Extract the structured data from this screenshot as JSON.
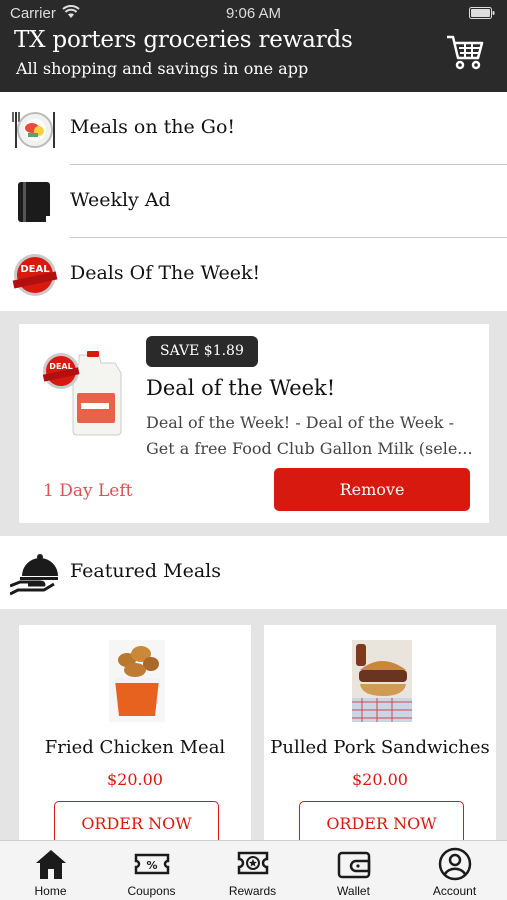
{
  "status_bar": {
    "carrier": "Carrier",
    "time": "9:06 AM"
  },
  "header": {
    "title": "TX porters groceries rewards",
    "subtitle": "All shopping and savings in one app",
    "cart_icon": "cart-icon"
  },
  "menu": [
    {
      "label": "Meals on the Go!",
      "icon": "meal-plate-icon"
    },
    {
      "label": "Weekly Ad",
      "icon": "book-icon"
    },
    {
      "label": "Deals Of The Week!",
      "icon": "deal-badge-icon"
    }
  ],
  "deal": {
    "badge": "SAVE $1.89",
    "title": "Deal of the Week!",
    "description_line1": "Deal of the Week! - Deal of the Week -",
    "description_line2": "Get a free Food Club Gallon Milk (sele...",
    "days_left": "1 Day Left",
    "remove_label": "Remove"
  },
  "featured": {
    "label": "Featured Meals",
    "icon": "cloche-icon",
    "meals": [
      {
        "name": "Fried Chicken Meal",
        "price": "$20.00",
        "order_label": "ORDER NOW"
      },
      {
        "name": "Pulled Pork Sandwiches",
        "price": "$20.00",
        "order_label": "ORDER NOW"
      }
    ]
  },
  "tabs": [
    {
      "label": "Home",
      "icon": "home-icon"
    },
    {
      "label": "Coupons",
      "icon": "coupon-icon"
    },
    {
      "label": "Rewards",
      "icon": "rewards-icon"
    },
    {
      "label": "Wallet",
      "icon": "wallet-icon"
    },
    {
      "label": "Account",
      "icon": "account-icon"
    }
  ],
  "colors": {
    "header_bg": "#2a2a2a",
    "accent_red": "#d7190f",
    "section_grey": "#e4e4e4"
  }
}
